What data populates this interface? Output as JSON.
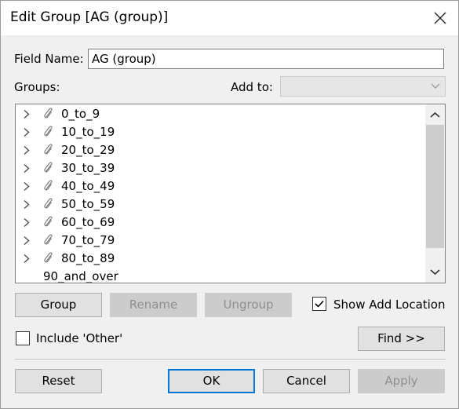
{
  "window": {
    "title": "Edit Group [AG (group)]"
  },
  "field": {
    "label": "Field Name:",
    "value": "AG (group)"
  },
  "groups": {
    "label": "Groups:"
  },
  "add_to": {
    "label": "Add to:",
    "value": ""
  },
  "tree": {
    "items": [
      {
        "label": "0_to_9",
        "type": "group"
      },
      {
        "label": "10_to_19",
        "type": "group"
      },
      {
        "label": "20_to_29",
        "type": "group"
      },
      {
        "label": "30_to_39",
        "type": "group"
      },
      {
        "label": "40_to_49",
        "type": "group"
      },
      {
        "label": "50_to_59",
        "type": "group"
      },
      {
        "label": "60_to_69",
        "type": "group"
      },
      {
        "label": "70_to_79",
        "type": "group"
      },
      {
        "label": "80_to_89",
        "type": "group"
      },
      {
        "label": "90_and_over",
        "type": "member"
      }
    ]
  },
  "buttons": {
    "group": "Group",
    "rename": "Rename",
    "ungroup": "Ungroup",
    "find": "Find >>",
    "reset": "Reset",
    "ok": "OK",
    "cancel": "Cancel",
    "apply": "Apply"
  },
  "options": {
    "show_add_location": {
      "label": "Show Add Location",
      "checked": true
    },
    "include_other": {
      "label": "Include 'Other'",
      "checked": false
    }
  },
  "colors": {
    "accent": "#0078d7"
  }
}
